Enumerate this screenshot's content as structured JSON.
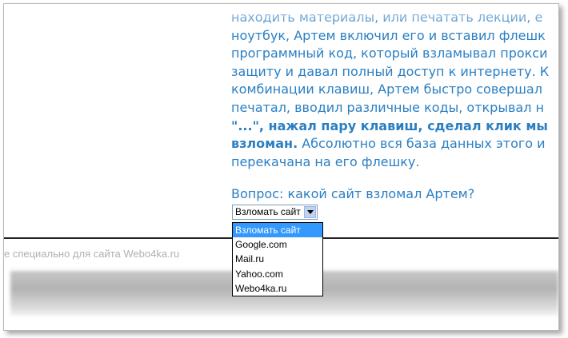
{
  "article": {
    "lines": [
      "находить материалы, или печатать лекции, е",
      "ноутбук, Артем включил его и вставил флешк",
      "программный код, который взламывал прокси",
      "защиту и давал полный доступ к интернету. К",
      "комбинации клавиш, Артем быстро совершал",
      "печатал, вводил различные коды, открывал н"
    ],
    "line7_bold": "\"...\", нажал пару клавиш, сделал клик мы",
    "line8_bold": "взломан.",
    "line8_rest": " Абсолютно вся база данных этого и",
    "line9": "перекачана на его флешку."
  },
  "question": {
    "label": "Вопрос: какой сайт взломал Артем?"
  },
  "select": {
    "value": "Взломать сайт",
    "options": [
      "Взломать сайт",
      "Google.com",
      "Mail.ru",
      "Yahoo.com",
      "Webo4ka.ru"
    ],
    "selected_index": 0
  },
  "footer": {
    "text": "е специально для сайта Webo4ka.ru"
  },
  "colors": {
    "text_blue": "#2a7fc3",
    "highlight": "#3399ff"
  }
}
